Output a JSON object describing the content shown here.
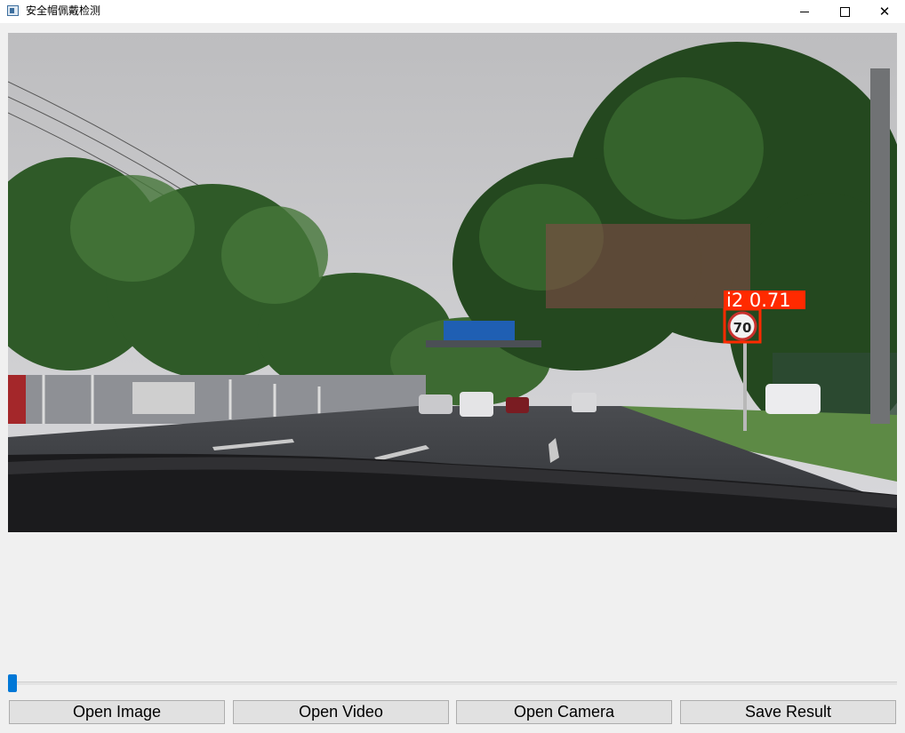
{
  "window": {
    "title": "安全帽佩戴检测",
    "controls": {
      "minimize": "minimize-icon",
      "maximize": "maximize-icon",
      "close": "close-icon"
    }
  },
  "display": {
    "detection": {
      "label": "i2",
      "confidence": "0.71",
      "box_color": "#ff2a00"
    },
    "sign_text": "70"
  },
  "slider": {
    "value": 0
  },
  "buttons": {
    "open_image": "Open Image",
    "open_video": "Open Video",
    "open_camera": "Open Camera",
    "save_result": "Save Result"
  }
}
